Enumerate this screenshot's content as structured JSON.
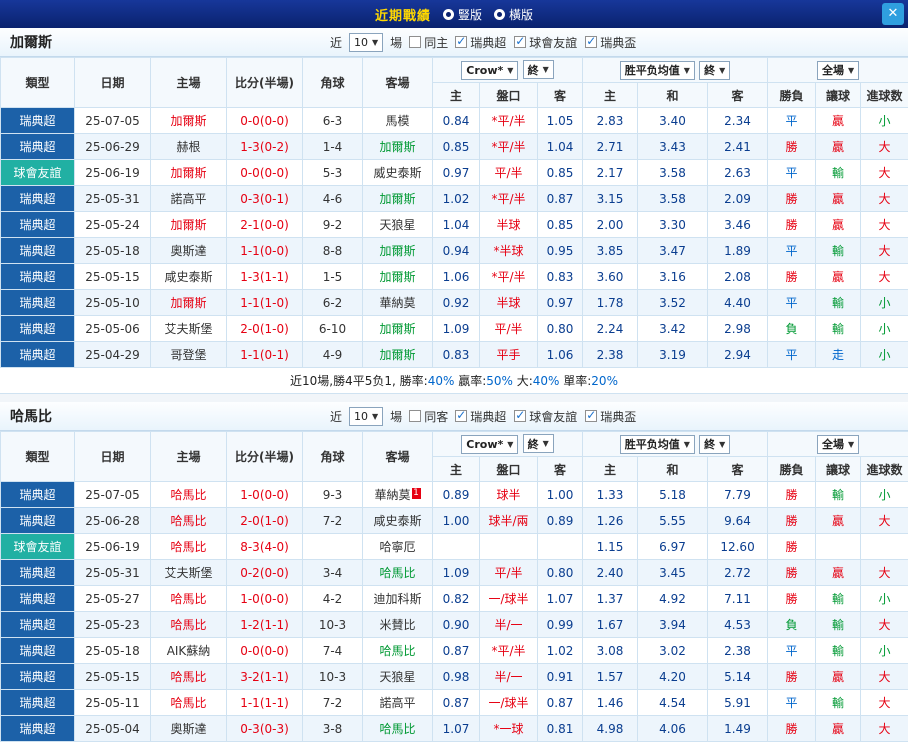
{
  "topbar": {
    "title": "近期戰績",
    "layout_options": [
      {
        "label": "豎版"
      },
      {
        "label": "橫版"
      }
    ],
    "close_label": "✕"
  },
  "columns": {
    "type": "類型",
    "date": "日期",
    "home": "主場",
    "score": "比分(半場)",
    "corner": "角球",
    "away": "客場",
    "ah_home": "主",
    "handicap": "盤口",
    "ah_away": "客",
    "eu_home": "主",
    "eu_draw": "和",
    "eu_away": "客",
    "result": "勝負",
    "let_ball": "讓球",
    "goals": "進球数"
  },
  "colors": {
    "league_super": "#1c61a8",
    "league_friendly": "#21b0a3",
    "win_red": "#e60012",
    "lose_green": "#009933",
    "draw_blue": "#0066cc",
    "topbar_bg": "#0f2c85",
    "title_yellow": "#ffd800"
  },
  "sections": [
    {
      "team": "加爾斯",
      "controls": {
        "near_label": "近",
        "count_value": "10",
        "games_label": "場",
        "same_option": {
          "label": "同主",
          "checked": false
        },
        "leagues": [
          {
            "label": "瑞典超",
            "checked": true
          },
          {
            "label": "球會友誼",
            "checked": true
          },
          {
            "label": "瑞典盃",
            "checked": true
          }
        ]
      },
      "filters": {
        "bookmaker": "Crow*",
        "bookmaker_final": "終",
        "avg": "胜平负均值",
        "avg_final": "終",
        "scope": "全場"
      },
      "rows": [
        {
          "type": "瑞典超",
          "type_cls": "lg-super",
          "date": "25-07-05",
          "home": "加爾斯",
          "home_cls": "red",
          "score": "0-0(0-0)",
          "corner": "6-3",
          "away": "馬模",
          "away_cls": "",
          "away_badge": "",
          "ah": [
            "0.84",
            "*平/半",
            "1.05"
          ],
          "eu": [
            "2.83",
            "3.40",
            "2.34"
          ],
          "res": "平",
          "res_cls": "blue",
          "let": "贏",
          "let_cls": "red",
          "goal": "小",
          "goal_cls": "green"
        },
        {
          "type": "瑞典超",
          "type_cls": "lg-super",
          "date": "25-06-29",
          "home": "赫根",
          "home_cls": "",
          "score": "1-3(0-2)",
          "corner": "1-4",
          "away": "加爾斯",
          "away_cls": "green",
          "away_badge": "",
          "ah": [
            "0.85",
            "*平/半",
            "1.04"
          ],
          "eu": [
            "2.71",
            "3.43",
            "2.41"
          ],
          "res": "勝",
          "res_cls": "red",
          "let": "贏",
          "let_cls": "red",
          "goal": "大",
          "goal_cls": "red"
        },
        {
          "type": "球會友誼",
          "type_cls": "lg-friendly",
          "date": "25-06-19",
          "home": "加爾斯",
          "home_cls": "red",
          "score": "0-0(0-0)",
          "corner": "5-3",
          "away": "威史泰斯",
          "away_cls": "",
          "away_badge": "",
          "ah": [
            "0.97",
            "平/半",
            "0.85"
          ],
          "eu": [
            "2.17",
            "3.58",
            "2.63"
          ],
          "res": "平",
          "res_cls": "blue",
          "let": "輸",
          "let_cls": "green",
          "goal": "大",
          "goal_cls": "red"
        },
        {
          "type": "瑞典超",
          "type_cls": "lg-super",
          "date": "25-05-31",
          "home": "諾高平",
          "home_cls": "",
          "score": "0-3(0-1)",
          "corner": "4-6",
          "away": "加爾斯",
          "away_cls": "green",
          "away_badge": "",
          "ah": [
            "1.02",
            "*平/半",
            "0.87"
          ],
          "eu": [
            "3.15",
            "3.58",
            "2.09"
          ],
          "res": "勝",
          "res_cls": "red",
          "let": "贏",
          "let_cls": "red",
          "goal": "大",
          "goal_cls": "red"
        },
        {
          "type": "瑞典超",
          "type_cls": "lg-super",
          "date": "25-05-24",
          "home": "加爾斯",
          "home_cls": "red",
          "score": "2-1(0-0)",
          "corner": "9-2",
          "away": "天狼星",
          "away_cls": "",
          "away_badge": "",
          "ah": [
            "1.04",
            "半球",
            "0.85"
          ],
          "eu": [
            "2.00",
            "3.30",
            "3.46"
          ],
          "res": "勝",
          "res_cls": "red",
          "let": "贏",
          "let_cls": "red",
          "goal": "大",
          "goal_cls": "red"
        },
        {
          "type": "瑞典超",
          "type_cls": "lg-super",
          "date": "25-05-18",
          "home": "奧斯達",
          "home_cls": "",
          "score": "1-1(0-0)",
          "corner": "8-8",
          "away": "加爾斯",
          "away_cls": "green",
          "away_badge": "",
          "ah": [
            "0.94",
            "*半球",
            "0.95"
          ],
          "eu": [
            "3.85",
            "3.47",
            "1.89"
          ],
          "res": "平",
          "res_cls": "blue",
          "let": "輸",
          "let_cls": "green",
          "goal": "大",
          "goal_cls": "red"
        },
        {
          "type": "瑞典超",
          "type_cls": "lg-super",
          "date": "25-05-15",
          "home": "咸史泰斯",
          "home_cls": "",
          "score": "1-3(1-1)",
          "corner": "1-5",
          "away": "加爾斯",
          "away_cls": "green",
          "away_badge": "",
          "ah": [
            "1.06",
            "*平/半",
            "0.83"
          ],
          "eu": [
            "3.60",
            "3.16",
            "2.08"
          ],
          "res": "勝",
          "res_cls": "red",
          "let": "贏",
          "let_cls": "red",
          "goal": "大",
          "goal_cls": "red"
        },
        {
          "type": "瑞典超",
          "type_cls": "lg-super",
          "date": "25-05-10",
          "home": "加爾斯",
          "home_cls": "red",
          "score": "1-1(1-0)",
          "corner": "6-2",
          "away": "華納莫",
          "away_cls": "",
          "away_badge": "",
          "ah": [
            "0.92",
            "半球",
            "0.97"
          ],
          "eu": [
            "1.78",
            "3.52",
            "4.40"
          ],
          "res": "平",
          "res_cls": "blue",
          "let": "輸",
          "let_cls": "green",
          "goal": "小",
          "goal_cls": "green"
        },
        {
          "type": "瑞典超",
          "type_cls": "lg-super",
          "date": "25-05-06",
          "home": "艾夫斯堡",
          "home_cls": "",
          "score": "2-0(1-0)",
          "corner": "6-10",
          "away": "加爾斯",
          "away_cls": "green",
          "away_badge": "",
          "ah": [
            "1.09",
            "平/半",
            "0.80"
          ],
          "eu": [
            "2.24",
            "3.42",
            "2.98"
          ],
          "res": "負",
          "res_cls": "green",
          "let": "輸",
          "let_cls": "green",
          "goal": "小",
          "goal_cls": "green"
        },
        {
          "type": "瑞典超",
          "type_cls": "lg-super",
          "date": "25-04-29",
          "home": "哥登堡",
          "home_cls": "",
          "score": "1-1(0-1)",
          "corner": "4-9",
          "away": "加爾斯",
          "away_cls": "green",
          "away_badge": "",
          "ah": [
            "0.83",
            "平手",
            "1.06"
          ],
          "eu": [
            "2.38",
            "3.19",
            "2.94"
          ],
          "res": "平",
          "res_cls": "blue",
          "let": "走",
          "let_cls": "blue",
          "goal": "小",
          "goal_cls": "green"
        }
      ],
      "summary": {
        "prefix": "近10場,勝4平5负1,",
        "stats": [
          {
            "label": "勝率:",
            "value": "40%"
          },
          {
            "label": "贏率:",
            "value": "50%"
          },
          {
            "label": "大:",
            "value": "40%"
          },
          {
            "label": "單率:",
            "value": "20%"
          }
        ]
      }
    },
    {
      "team": "哈馬比",
      "controls": {
        "near_label": "近",
        "count_value": "10",
        "games_label": "場",
        "same_option": {
          "label": "同客",
          "checked": false
        },
        "leagues": [
          {
            "label": "瑞典超",
            "checked": true
          },
          {
            "label": "球會友誼",
            "checked": true
          },
          {
            "label": "瑞典盃",
            "checked": true
          }
        ]
      },
      "filters": {
        "bookmaker": "Crow*",
        "bookmaker_final": "終",
        "avg": "胜平负均值",
        "avg_final": "終",
        "scope": "全場"
      },
      "rows": [
        {
          "type": "瑞典超",
          "type_cls": "lg-super",
          "date": "25-07-05",
          "home": "哈馬比",
          "home_cls": "red",
          "score": "1-0(0-0)",
          "corner": "9-3",
          "away": "華納莫",
          "away_cls": "",
          "away_badge": "1",
          "ah": [
            "0.89",
            "球半",
            "1.00"
          ],
          "eu": [
            "1.33",
            "5.18",
            "7.79"
          ],
          "res": "勝",
          "res_cls": "red",
          "let": "輸",
          "let_cls": "green",
          "goal": "小",
          "goal_cls": "green"
        },
        {
          "type": "瑞典超",
          "type_cls": "lg-super",
          "date": "25-06-28",
          "home": "哈馬比",
          "home_cls": "red",
          "score": "2-0(1-0)",
          "corner": "7-2",
          "away": "咸史泰斯",
          "away_cls": "",
          "away_badge": "",
          "ah": [
            "1.00",
            "球半/兩",
            "0.89"
          ],
          "eu": [
            "1.26",
            "5.55",
            "9.64"
          ],
          "res": "勝",
          "res_cls": "red",
          "let": "贏",
          "let_cls": "red",
          "goal": "大",
          "goal_cls": "red"
        },
        {
          "type": "球會友誼",
          "type_cls": "lg-friendly",
          "date": "25-06-19",
          "home": "哈馬比",
          "home_cls": "red",
          "score": "8-3(4-0)",
          "corner": "",
          "away": "哈寧厄",
          "away_cls": "",
          "away_badge": "",
          "ah": [
            "",
            "",
            ""
          ],
          "eu": [
            "1.15",
            "6.97",
            "12.60"
          ],
          "res": "勝",
          "res_cls": "red",
          "let": "",
          "let_cls": "",
          "goal": "",
          "goal_cls": ""
        },
        {
          "type": "瑞典超",
          "type_cls": "lg-super",
          "date": "25-05-31",
          "home": "艾夫斯堡",
          "home_cls": "",
          "score": "0-2(0-0)",
          "corner": "3-4",
          "away": "哈馬比",
          "away_cls": "green",
          "away_badge": "",
          "ah": [
            "1.09",
            "平/半",
            "0.80"
          ],
          "eu": [
            "2.40",
            "3.45",
            "2.72"
          ],
          "res": "勝",
          "res_cls": "red",
          "let": "贏",
          "let_cls": "red",
          "goal": "大",
          "goal_cls": "red"
        },
        {
          "type": "瑞典超",
          "type_cls": "lg-super",
          "date": "25-05-27",
          "home": "哈馬比",
          "home_cls": "red",
          "score": "1-0(0-0)",
          "corner": "4-2",
          "away": "迪加科斯",
          "away_cls": "",
          "away_badge": "",
          "ah": [
            "0.82",
            "一/球半",
            "1.07"
          ],
          "eu": [
            "1.37",
            "4.92",
            "7.11"
          ],
          "res": "勝",
          "res_cls": "red",
          "let": "輸",
          "let_cls": "green",
          "goal": "小",
          "goal_cls": "green"
        },
        {
          "type": "瑞典超",
          "type_cls": "lg-super",
          "date": "25-05-23",
          "home": "哈馬比",
          "home_cls": "red",
          "score": "1-2(1-1)",
          "corner": "10-3",
          "away": "米賛比",
          "away_cls": "",
          "away_badge": "",
          "ah": [
            "0.90",
            "半/一",
            "0.99"
          ],
          "eu": [
            "1.67",
            "3.94",
            "4.53"
          ],
          "res": "負",
          "res_cls": "green",
          "let": "輸",
          "let_cls": "green",
          "goal": "大",
          "goal_cls": "red"
        },
        {
          "type": "瑞典超",
          "type_cls": "lg-super",
          "date": "25-05-18",
          "home": "AIK蘇納",
          "home_cls": "",
          "score": "0-0(0-0)",
          "corner": "7-4",
          "away": "哈馬比",
          "away_cls": "green",
          "away_badge": "",
          "ah": [
            "0.87",
            "*平/半",
            "1.02"
          ],
          "eu": [
            "3.08",
            "3.02",
            "2.38"
          ],
          "res": "平",
          "res_cls": "blue",
          "let": "輸",
          "let_cls": "green",
          "goal": "小",
          "goal_cls": "green"
        },
        {
          "type": "瑞典超",
          "type_cls": "lg-super",
          "date": "25-05-15",
          "home": "哈馬比",
          "home_cls": "red",
          "score": "3-2(1-1)",
          "corner": "10-3",
          "away": "天狼星",
          "away_cls": "",
          "away_badge": "",
          "ah": [
            "0.98",
            "半/一",
            "0.91"
          ],
          "eu": [
            "1.57",
            "4.20",
            "5.14"
          ],
          "res": "勝",
          "res_cls": "red",
          "let": "贏",
          "let_cls": "red",
          "goal": "大",
          "goal_cls": "red"
        },
        {
          "type": "瑞典超",
          "type_cls": "lg-super",
          "date": "25-05-11",
          "home": "哈馬比",
          "home_cls": "red",
          "score": "1-1(1-1)",
          "corner": "7-2",
          "away": "諾高平",
          "away_cls": "",
          "away_badge": "",
          "ah": [
            "0.87",
            "一/球半",
            "0.87"
          ],
          "eu": [
            "1.46",
            "4.54",
            "5.91"
          ],
          "res": "平",
          "res_cls": "blue",
          "let": "輸",
          "let_cls": "green",
          "goal": "大",
          "goal_cls": "red"
        },
        {
          "type": "瑞典超",
          "type_cls": "lg-super",
          "date": "25-05-04",
          "home": "奧斯達",
          "home_cls": "",
          "score": "0-3(0-3)",
          "corner": "3-8",
          "away": "哈馬比",
          "away_cls": "green",
          "away_badge": "",
          "ah": [
            "1.07",
            "*一球",
            "0.81"
          ],
          "eu": [
            "4.98",
            "4.06",
            "1.49"
          ],
          "res": "勝",
          "res_cls": "red",
          "let": "贏",
          "let_cls": "red",
          "goal": "大",
          "goal_cls": "red"
        }
      ]
    }
  ]
}
